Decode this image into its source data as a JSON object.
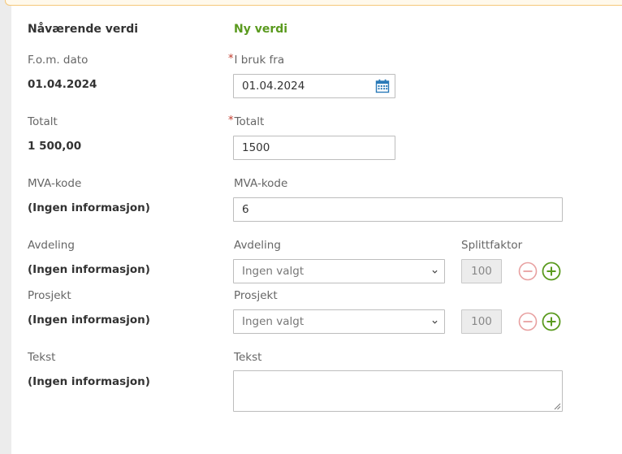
{
  "headers": {
    "current": "Nåværende verdi",
    "new": "Ny verdi"
  },
  "fom": {
    "current_label": "F.o.m. dato",
    "current_value": "01.04.2024",
    "new_label": "I bruk fra",
    "new_value": "01.04.2024",
    "required": true
  },
  "total": {
    "current_label": "Totalt",
    "current_value": "1 500,00",
    "new_label": "Totalt",
    "new_value": "1500",
    "required": true
  },
  "mva": {
    "current_label": "MVA-kode",
    "current_value": "(Ingen informasjon)",
    "new_label": "MVA-kode",
    "new_value": "6"
  },
  "avdeling": {
    "current_label": "Avdeling",
    "current_value": "(Ingen informasjon)",
    "new_label": "Avdeling",
    "selected": "Ingen valgt",
    "split_label": "Splittfaktor",
    "split_value": "100"
  },
  "prosjekt": {
    "current_label": "Prosjekt",
    "current_value": "(Ingen informasjon)",
    "new_label": "Prosjekt",
    "selected": "Ingen valgt",
    "split_value": "100"
  },
  "tekst": {
    "current_label": "Tekst",
    "current_value": "(Ingen informasjon)",
    "new_label": "Tekst",
    "new_value": ""
  },
  "colors": {
    "accent_green": "#5a9a1e",
    "remove_red": "#e8a0a0",
    "required_red": "#c0392b",
    "calendar_blue": "#2a7ab8"
  }
}
